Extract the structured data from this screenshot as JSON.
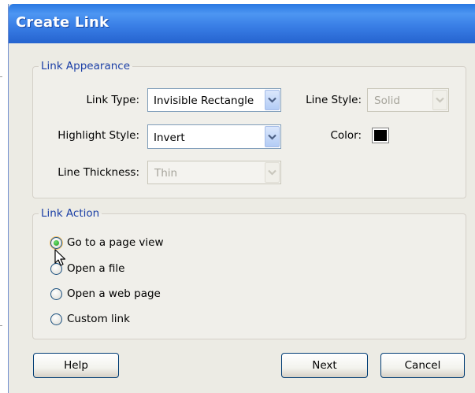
{
  "dialog": {
    "title": "Create Link"
  },
  "link_appearance": {
    "legend": "Link Appearance",
    "link_type_label": "Link Type:",
    "link_type_value": "Invisible Rectangle",
    "highlight_style_label": "Highlight Style:",
    "highlight_style_value": "Invert",
    "line_thickness_label": "Line Thickness:",
    "line_thickness_value": "Thin",
    "line_style_label": "Line Style:",
    "line_style_value": "Solid",
    "color_label": "Color:",
    "color_value": "#000000"
  },
  "link_action": {
    "legend": "Link Action",
    "options": [
      {
        "label": "Go to a page view",
        "selected": true
      },
      {
        "label": "Open a file",
        "selected": false
      },
      {
        "label": "Open a web page",
        "selected": false
      },
      {
        "label": "Custom link",
        "selected": false
      }
    ]
  },
  "buttons": {
    "help": "Help",
    "next": "Next",
    "cancel": "Cancel"
  },
  "colors": {
    "titlebar": "#2a78e2",
    "group_legend": "#1b3fa6",
    "dialog_bg": "#ecebe4"
  }
}
